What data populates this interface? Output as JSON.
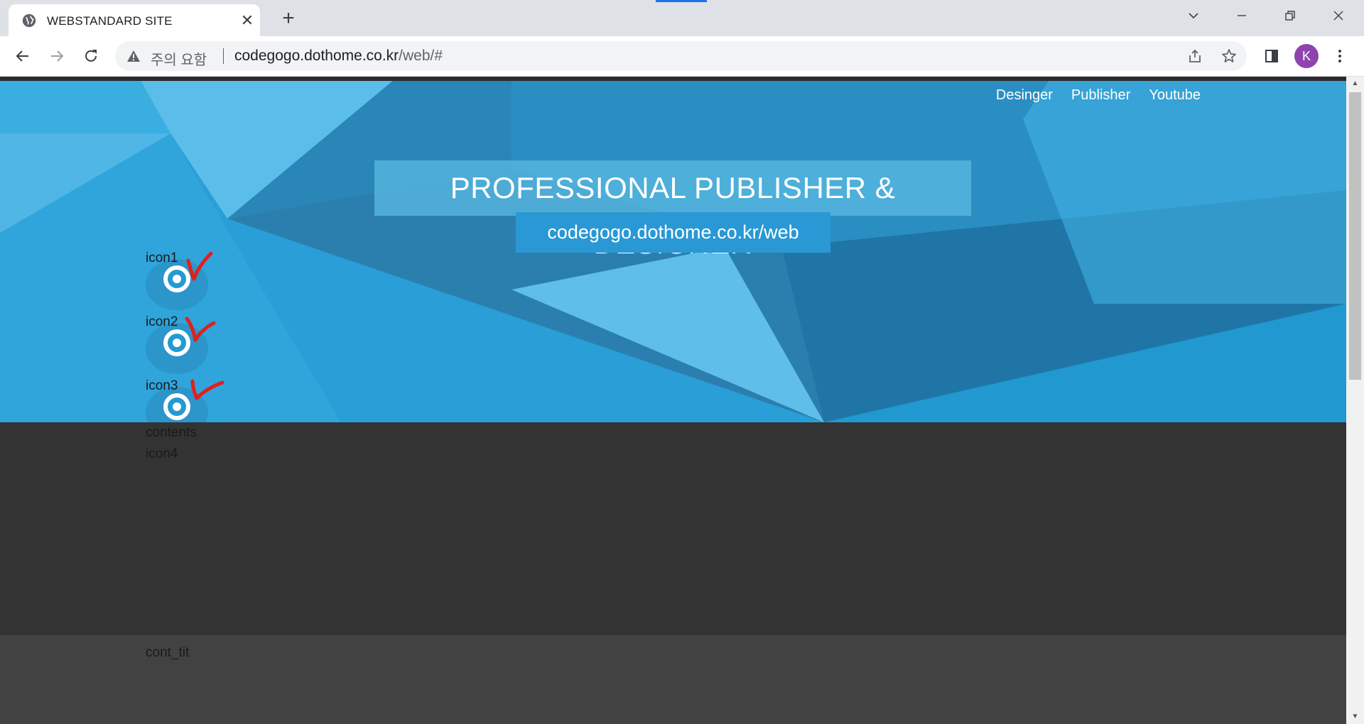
{
  "browser": {
    "tab_title": "WEBSTANDARD SITE",
    "security_text": "주의 요함",
    "url_host": "codegogo.dothome.co.kr",
    "url_path": "/web/#",
    "profile_initial": "K"
  },
  "page": {
    "nav": [
      "Desinger",
      "Publisher",
      "Youtube"
    ],
    "hero_title": "PROFESSIONAL PUBLISHER & DESIGNER",
    "hero_sub": "codegogo.dothome.co.kr/web",
    "icons": [
      "icon1",
      "icon2",
      "icon3"
    ],
    "contents_label": "contents",
    "icon4_label": "icon4",
    "cont_tit_label": "cont_tit"
  },
  "colors": {
    "header_blue": "#239bd2",
    "annotation_red": "#e0201c"
  }
}
